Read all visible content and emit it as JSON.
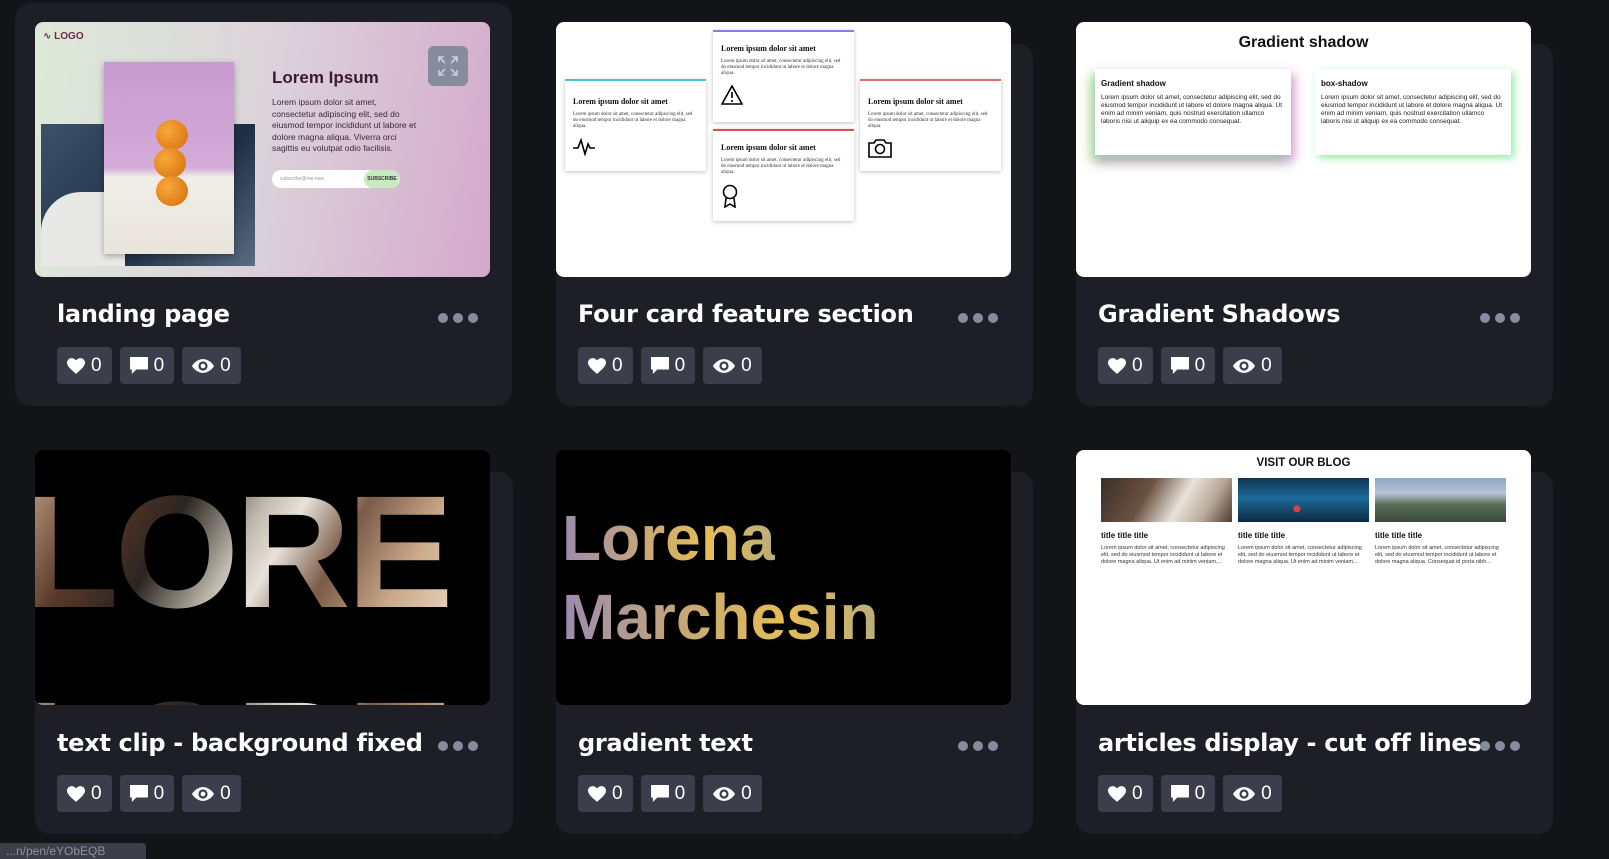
{
  "pens": [
    {
      "title": "landing page",
      "likes": "0",
      "comments": "0",
      "views": "0"
    },
    {
      "title": "Four card feature section",
      "likes": "0",
      "comments": "0",
      "views": "0"
    },
    {
      "title": "Gradient Shadows",
      "likes": "0",
      "comments": "0",
      "views": "0"
    },
    {
      "title": "text clip - background fixed",
      "likes": "0",
      "comments": "0",
      "views": "0"
    },
    {
      "title": "gradient text",
      "likes": "0",
      "comments": "0",
      "views": "0"
    },
    {
      "title": "articles display - cut off lines",
      "likes": "0",
      "comments": "0",
      "views": "0"
    }
  ],
  "previews": {
    "landing": {
      "logo": "∿ LOGO",
      "heading": "Lorem Ipsum",
      "text": "Lorem ipsum dolor sit amet, consectetur adipiscing elit, sed do eiusmod tempor incididunt ut labore et dolore magna aliqua. Viverra orci sagittis eu volutpat odio facilisis.",
      "input_placeholder": "subscribe@me.now",
      "button": "SUBSCRIBE"
    },
    "four_card": {
      "heading": "Lorem ipsum dolor sit amet",
      "text": "Lorem ipsum dolor sit amet, consectetur adipiscing elit, sed do eiusmod tempor incididunt ut labore et dolore magna aliqua."
    },
    "gradient_shadow": {
      "heading": "Gradient shadow",
      "card1_title": "Gradient shadow",
      "card2_title": "box-shadow",
      "text": "Lorem ipsum dolor sit amet, consectetur adipiscing elit, sed do eiusmod tempor incididunt ut labore et dolore magna aliqua. Ut enim ad minim veniam, quis nostrud exercitation ullamco laboris nisi ut aliquip ex ea commodo consequat."
    },
    "text_clip": {
      "row1": "LORE",
      "row2": "LORE"
    },
    "gradient_text": {
      "line1": "Lorena",
      "line2": "Marchesin"
    },
    "blog": {
      "heading": "VISIT OUR BLOG",
      "articles": [
        {
          "title": "title title title",
          "text": "Lorem ipsum dolor sit amet, consectetur adipiscing elit, sed do eiusmod tempor incididunt ut labore et dolore magna aliqua. Ut enim ad minim veniam,..."
        },
        {
          "title": "title title title",
          "text": "Lorem ipsum dolor sit amet, consectetur adipiscing elit, sed do eiusmod tempor incididunt ut labore et dolore magna aliqua. Ut enim ad minim veniam,..."
        },
        {
          "title": "title title title",
          "text": "Lorem ipsum dolor sit amet, consectetur adipiscing elit, sed do eiusmod tempor incididunt ut labore et dolore magna aliqua. Consequat id porta nibh..."
        }
      ]
    }
  },
  "status_url": "...n/pen/eYObEQB",
  "colors": {
    "page_bg": "#131417",
    "card_bg": "#1e1f26",
    "stat_bg": "#3c3e4b"
  }
}
